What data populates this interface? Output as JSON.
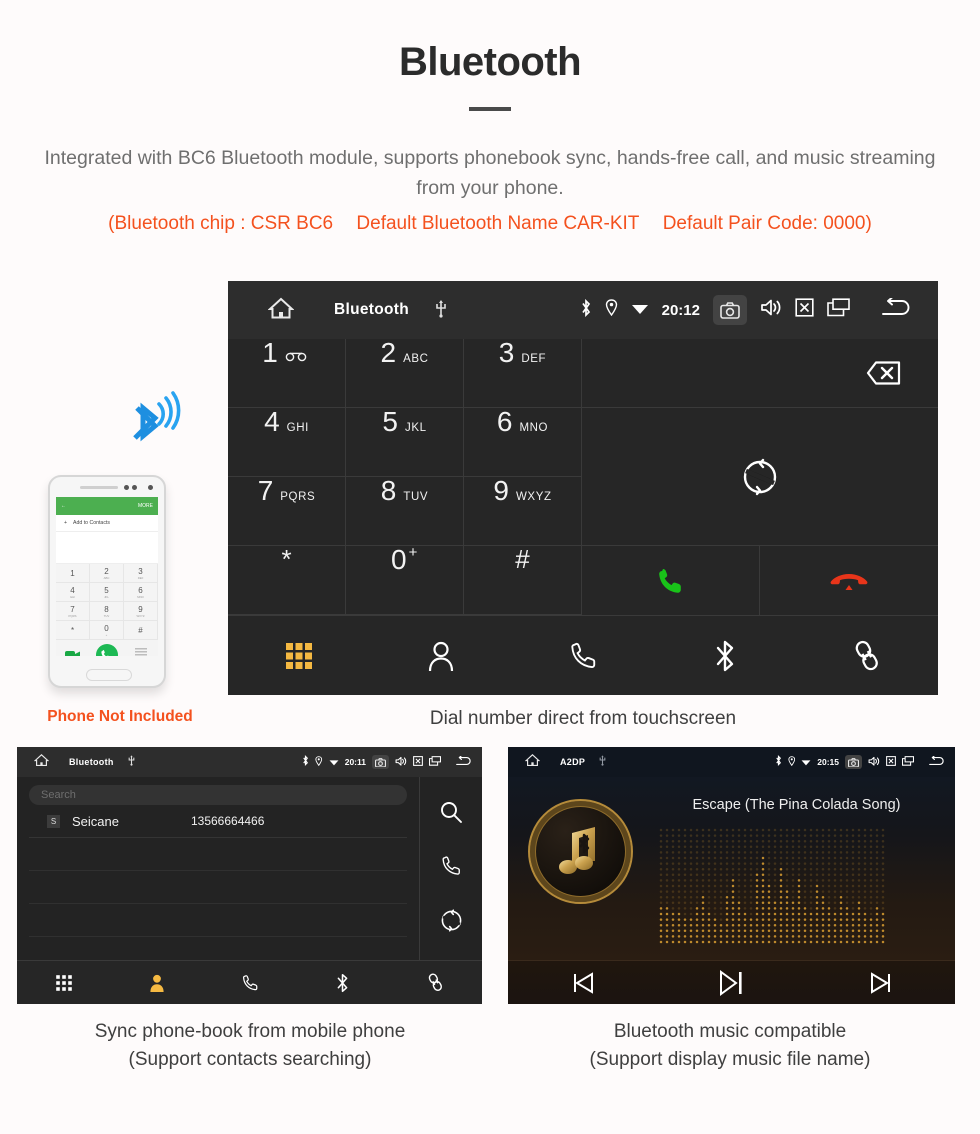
{
  "header": {
    "title": "Bluetooth",
    "intro": "Integrated with BC6 Bluetooth module, supports phonebook sync, hands-free call, and music streaming from your phone.",
    "specs": [
      "(Bluetooth chip : CSR BC6",
      "Default Bluetooth Name CAR-KIT",
      "Default Pair Code: 0000)"
    ],
    "accent_color": "#f4511e",
    "body_color": "#6f6f6f"
  },
  "dialer": {
    "statusbar": {
      "home": "home-icon",
      "title": "Bluetooth",
      "usb": "usb-icon",
      "bluetooth": "bluetooth-icon",
      "location": "location-icon",
      "wifi": "wifi-icon",
      "clock": "20:12",
      "camera": "camera-icon",
      "volume": "volume-icon",
      "close": "close-box-icon",
      "windows": "recent-apps-icon",
      "back": "back-icon"
    },
    "keys": [
      {
        "digit": "1",
        "sub": "∞",
        "sub_type": "voicemail"
      },
      {
        "digit": "2",
        "sub": "ABC"
      },
      {
        "digit": "3",
        "sub": "DEF"
      },
      {
        "digit": "4",
        "sub": "GHI"
      },
      {
        "digit": "5",
        "sub": "JKL"
      },
      {
        "digit": "6",
        "sub": "MNO"
      },
      {
        "digit": "7",
        "sub": "PQRS"
      },
      {
        "digit": "8",
        "sub": "TUV"
      },
      {
        "digit": "9",
        "sub": "WXYZ"
      },
      {
        "digit": "*",
        "sub": ""
      },
      {
        "digit": "0",
        "sub": "+",
        "sub_type": "sup"
      },
      {
        "digit": "#",
        "sub": ""
      }
    ],
    "actions": {
      "backspace": "backspace-icon",
      "sync": "sync-icon",
      "call": "call-icon",
      "hangup": "hangup-icon",
      "call_color": "#19c319",
      "hangup_color": "#e8351a"
    },
    "tabs": [
      {
        "name": "keypad",
        "icon": "keypad-icon",
        "active": true
      },
      {
        "name": "contacts",
        "icon": "contact-icon",
        "active": false
      },
      {
        "name": "call-log",
        "icon": "phone-icon",
        "active": false
      },
      {
        "name": "bluetooth",
        "icon": "bluetooth-icon",
        "active": false
      },
      {
        "name": "pair",
        "icon": "link-icon",
        "active": false
      }
    ],
    "active_tab_color": "#f5b942",
    "caption": "Dial number direct from touchscreen"
  },
  "phone_mockup": {
    "bluetooth_wave": "bluetooth-signal-icon",
    "screen": {
      "appbar_back": "back-arrow-icon",
      "appbar_more": "MORE",
      "add_contact": "Add to Contacts",
      "keys": [
        {
          "digit": "1",
          "sub": ""
        },
        {
          "digit": "2",
          "sub": "ABC"
        },
        {
          "digit": "3",
          "sub": "DEF"
        },
        {
          "digit": "4",
          "sub": "GHI"
        },
        {
          "digit": "5",
          "sub": "JKL"
        },
        {
          "digit": "6",
          "sub": "MNO"
        },
        {
          "digit": "7",
          "sub": "PQRS"
        },
        {
          "digit": "8",
          "sub": "TUV"
        },
        {
          "digit": "9",
          "sub": "WXYZ"
        },
        {
          "digit": "*",
          "sub": ""
        },
        {
          "digit": "0",
          "sub": "+"
        },
        {
          "digit": "#",
          "sub": ""
        }
      ]
    },
    "not_included_label": "Phone Not Included",
    "not_included_color": "#f4511e"
  },
  "phonebook": {
    "statusbar": {
      "title": "Bluetooth",
      "clock": "20:11"
    },
    "search_placeholder": "Search",
    "columns": [
      "name",
      "number"
    ],
    "contacts": [
      {
        "badge": "S",
        "name": "Seicane",
        "number": "13566664466"
      }
    ],
    "empty_rows": 4,
    "side_actions": [
      {
        "name": "search",
        "icon": "search-icon"
      },
      {
        "name": "dial",
        "icon": "phone-icon"
      },
      {
        "name": "sync",
        "icon": "sync-icon"
      }
    ],
    "tabs": [
      {
        "name": "keypad",
        "icon": "keypad-icon",
        "active": false
      },
      {
        "name": "contacts",
        "icon": "contact-filled-icon",
        "active": true
      },
      {
        "name": "call-log",
        "icon": "phone-icon",
        "active": false
      },
      {
        "name": "bluetooth",
        "icon": "bluetooth-icon",
        "active": false
      },
      {
        "name": "pair",
        "icon": "link-icon",
        "active": false
      }
    ],
    "caption_line1": "Sync phone-book from mobile phone",
    "caption_line2": "(Support contacts searching)"
  },
  "music": {
    "statusbar": {
      "title": "A2DP",
      "clock": "20:15"
    },
    "track_title": "Escape (The Pina Colada Song)",
    "album_art_icon": "bluetooth-music-note-icon",
    "controls": [
      {
        "name": "previous",
        "icon": "skip-previous-icon"
      },
      {
        "name": "play-pause",
        "icon": "play-pause-icon"
      },
      {
        "name": "next",
        "icon": "skip-next-icon"
      }
    ],
    "visualizer_color": "#c8912e",
    "caption_line1": "Bluetooth music compatible",
    "caption_line2": "(Support display music file name)"
  }
}
